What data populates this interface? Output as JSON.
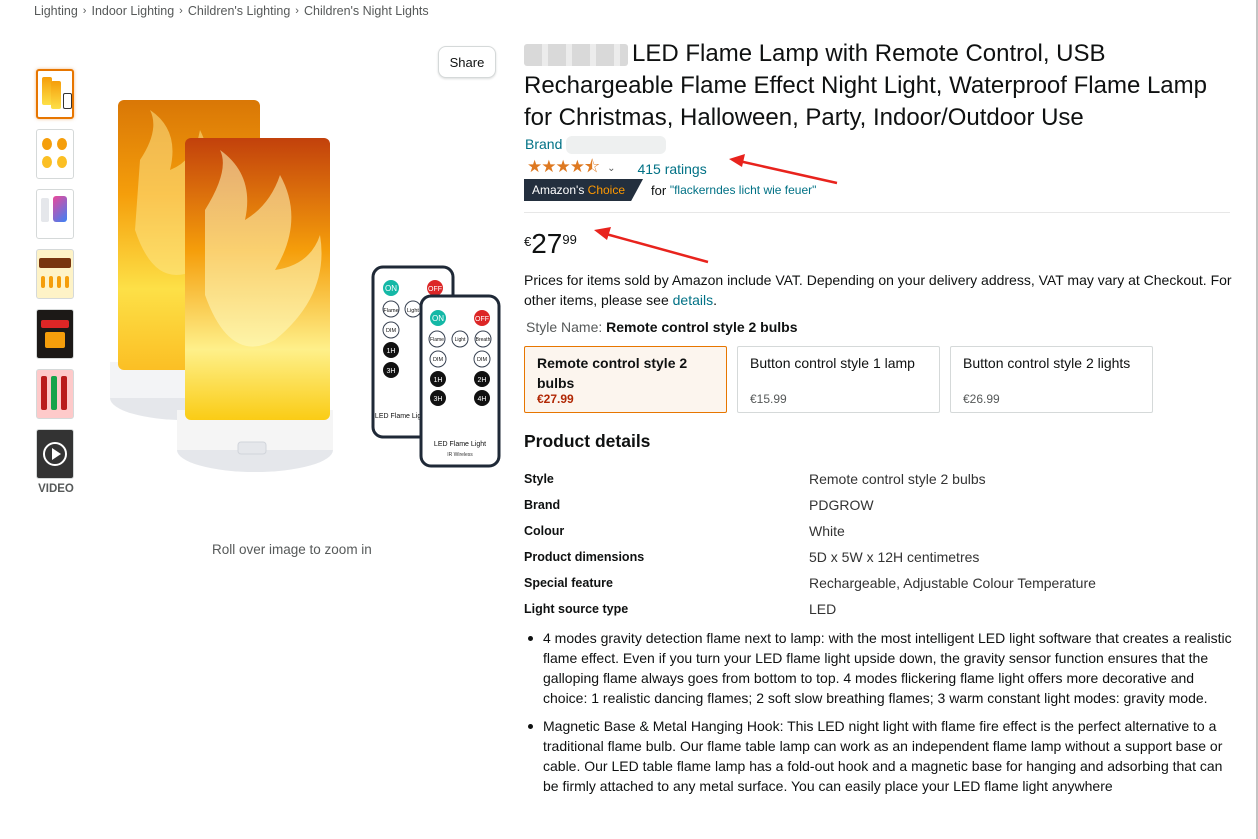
{
  "breadcrumb": [
    "Lighting",
    "Indoor Lighting",
    "Children's Lighting",
    "Children's Night Lights"
  ],
  "breadcrumb_sep": "›",
  "gallery": {
    "share_label": "Share",
    "video_label": "VIDEO",
    "zoom_hint": "Roll over image to zoom in",
    "remote_large": {
      "on": "ON",
      "off": "OFF",
      "b1": "Flame",
      "b2": "Light",
      "b3": "DIM",
      "b4": "1H",
      "b5": "3H",
      "brand": "LED Flame Light",
      "sub": "IR Wireless"
    },
    "remote_small": {
      "b1": "Flame",
      "b2": "Light",
      "b3": "Breath",
      "b4": "DIM",
      "b5": "DIM",
      "b6": "1H",
      "b7": "2H",
      "b8": "3H",
      "b9": "4H"
    }
  },
  "product": {
    "title": "LED Flame Lamp with Remote Control, USB Rechargeable Flame Effect Night Light, Waterproof Flame Lamp for Christmas, Halloween, Party, Indoor/Outdoor Use",
    "brand_label": "Brand",
    "stars": "★★★★⯪",
    "ratings": "415 ratings",
    "choice_badge_part1": "Amazon's",
    "choice_badge_part2": "Choice",
    "choice_for": "for",
    "choice_query": "\"flackerndes licht wie feuer\"",
    "price_currency": "€",
    "price_whole": "27",
    "price_fraction": "99",
    "vat_text": "Prices for items sold by Amazon include VAT. Depending on your delivery address, VAT may vary at Checkout. For other items, please see ",
    "vat_link": "details",
    "vat_end": ".",
    "style_name_label": "Style Name:",
    "style_name_value": "Remote control style 2 bulbs"
  },
  "variants": [
    {
      "name": "Remote control style 2 bulbs",
      "price": "€27.99",
      "selected": true
    },
    {
      "name": "Button control style 1 lamp",
      "price": "€15.99",
      "selected": false
    },
    {
      "name": "Button control style 2 lights",
      "price": "€26.99",
      "selected": false
    }
  ],
  "details": {
    "title": "Product details",
    "rows": [
      {
        "key": "Style",
        "value": "Remote control style 2 bulbs"
      },
      {
        "key": "Brand",
        "value": "PDGROW"
      },
      {
        "key": "Colour",
        "value": "White"
      },
      {
        "key": "Product dimensions",
        "value": "5D x 5W x 12H centimetres"
      },
      {
        "key": "Special feature",
        "value": "Rechargeable, Adjustable Colour Temperature"
      },
      {
        "key": "Light source type",
        "value": "LED"
      }
    ]
  },
  "bullets": [
    "4 modes gravity detection flame next to lamp: with the most intelligent LED light software that creates a realistic flame effect. Even if you turn your LED flame light upside down, the gravity sensor function ensures that the galloping flame always goes from bottom to top. 4 modes flickering flame light offers more decorative and choice: 1 realistic dancing flames; 2 soft slow breathing flames; 3 warm constant light modes: gravity mode.",
    "Magnetic Base & Metal Hanging Hook: This LED night light with flame fire effect is the perfect alternative to a traditional flame bulb. Our flame table lamp can work as an independent flame lamp without a support base or cable. Our LED table flame lamp has a fold-out hook and a magnetic base for hanging and adsorbing that can be firmly attached to any metal surface. You can easily place your LED flame light anywhere"
  ],
  "colors": {
    "link": "#007185",
    "star": "#de7921",
    "price_red": "#b12704",
    "selected_border": "#e77600",
    "arrow": "#e8231d"
  }
}
